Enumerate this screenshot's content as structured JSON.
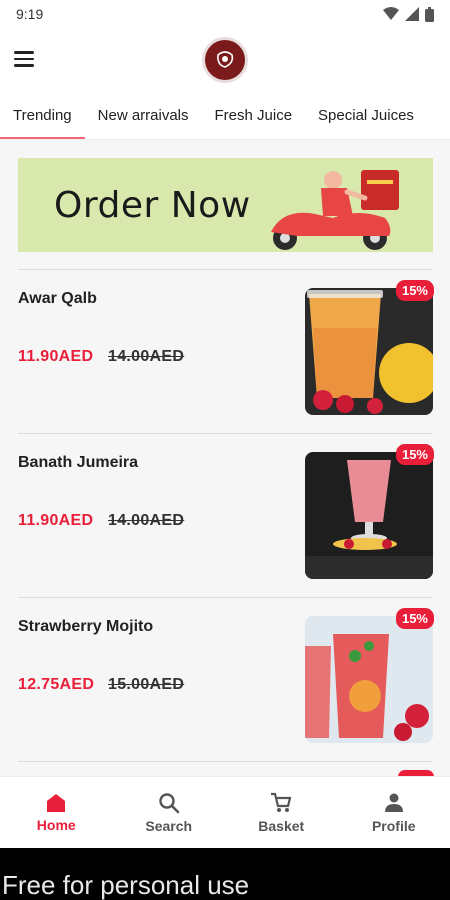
{
  "status_bar": {
    "time": "9:19"
  },
  "tabs": [
    {
      "label": "Trending"
    },
    {
      "label": "New arraivals"
    },
    {
      "label": "Fresh Juice"
    },
    {
      "label": "Special Juices"
    }
  ],
  "banner": {
    "text": "Order Now"
  },
  "products": [
    {
      "name": "Awar Qalb",
      "price": "11.90AED",
      "old_price": "14.00AED",
      "discount": "15%"
    },
    {
      "name": "Banath Jumeira",
      "price": "11.90AED",
      "old_price": "14.00AED",
      "discount": "15%"
    },
    {
      "name": "Strawberry Mojito",
      "price": "12.75AED",
      "old_price": "15.00AED",
      "discount": "15%"
    }
  ],
  "bottom_nav": [
    {
      "label": "Home",
      "icon": "home-icon"
    },
    {
      "label": "Search",
      "icon": "search-icon"
    },
    {
      "label": "Basket",
      "icon": "cart-icon"
    },
    {
      "label": "Profile",
      "icon": "person-icon"
    }
  ],
  "watermark": "Free for personal use",
  "colors": {
    "accent": "#e91f3a",
    "tab_indicator": "#f26b74",
    "banner_bg": "#d9e8ad"
  }
}
